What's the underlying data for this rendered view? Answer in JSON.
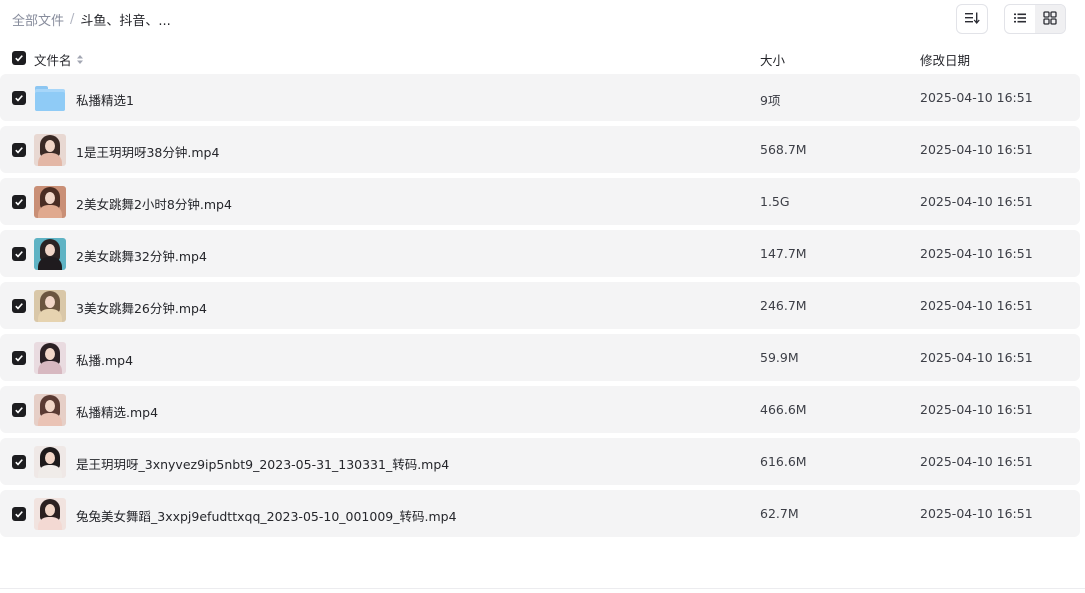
{
  "breadcrumb": {
    "root": "全部文件",
    "separator": "/",
    "current": "斗鱼、抖音、..."
  },
  "toolbar": {
    "sort_icon": "sort-list-icon",
    "view_list_icon": "list-view-icon",
    "view_grid_icon": "grid-view-icon",
    "active_view": "list"
  },
  "table": {
    "columns": {
      "name": "文件名",
      "size": "大小",
      "modified": "修改日期"
    },
    "rows": [
      {
        "name": "私播精选1",
        "size": "9项",
        "modified": "2025-04-10 16:51",
        "type": "folder",
        "checked": true
      },
      {
        "name": "1是王玥玥呀38分钟.mp4",
        "size": "568.7M",
        "modified": "2025-04-10 16:51",
        "type": "video",
        "checked": true,
        "thumb_colors": [
          "#e8d8d2",
          "#3a2a26",
          "#e3b7a6"
        ]
      },
      {
        "name": "2美女跳舞2小时8分钟.mp4",
        "size": "1.5G",
        "modified": "2025-04-10 16:51",
        "type": "video",
        "checked": true,
        "thumb_colors": [
          "#c98f76",
          "#4a2c22",
          "#e0a98e"
        ]
      },
      {
        "name": "2美女跳舞32分钟.mp4",
        "size": "147.7M",
        "modified": "2025-04-10 16:51",
        "type": "video",
        "checked": true,
        "thumb_colors": [
          "#5fb3c4",
          "#2b2323",
          "#1f1b1e"
        ]
      },
      {
        "name": "3美女跳舞26分钟.mp4",
        "size": "246.7M",
        "modified": "2025-04-10 16:51",
        "type": "video",
        "checked": true,
        "thumb_colors": [
          "#d9c7a8",
          "#6b5540",
          "#e6d3b0"
        ]
      },
      {
        "name": "私播.mp4",
        "size": "59.9M",
        "modified": "2025-04-10 16:51",
        "type": "video",
        "checked": true,
        "thumb_colors": [
          "#e9dbe0",
          "#2b2024",
          "#d7b8c0"
        ]
      },
      {
        "name": "私播精选.mp4",
        "size": "466.6M",
        "modified": "2025-04-10 16:51",
        "type": "video",
        "checked": true,
        "thumb_colors": [
          "#e6cfc7",
          "#5a3a33",
          "#eac3b5"
        ]
      },
      {
        "name": "是王玥玥呀_3xnyvez9ip5nbt9_2023-05-31_130331_转码.mp4",
        "size": "616.6M",
        "modified": "2025-04-10 16:51",
        "type": "video",
        "checked": true,
        "thumb_colors": [
          "#efe8e6",
          "#1d1a1b",
          "#f0ece9"
        ]
      },
      {
        "name": "兔兔美女舞蹈_3xxpj9efudttxqq_2023-05-10_001009_转码.mp4",
        "size": "62.7M",
        "modified": "2025-04-10 16:51",
        "type": "video",
        "checked": true,
        "thumb_colors": [
          "#f1e3df",
          "#2a2020",
          "#f3d9d3"
        ]
      }
    ]
  }
}
